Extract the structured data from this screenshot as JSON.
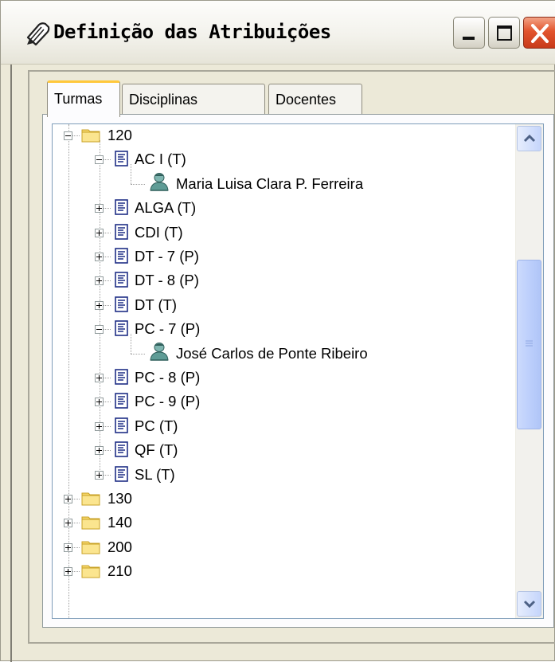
{
  "window": {
    "title": "Definição das Atribuições"
  },
  "tabs": [
    {
      "label": "Turmas",
      "active": true
    },
    {
      "label": "Disciplinas",
      "active": false
    },
    {
      "label": "Docentes",
      "active": false
    }
  ],
  "tree": [
    {
      "label": "120",
      "icon": "folder-icon",
      "expanded": true
    },
    {
      "label": "AC I (T)",
      "icon": "document-icon",
      "expanded": true
    },
    {
      "label": "Maria Luisa Clara P. Ferreira",
      "icon": "person-icon"
    },
    {
      "label": "ALGA (T)",
      "icon": "document-icon",
      "expanded": false
    },
    {
      "label": "CDI (T)",
      "icon": "document-icon",
      "expanded": false
    },
    {
      "label": "DT - 7 (P)",
      "icon": "document-icon",
      "expanded": false
    },
    {
      "label": "DT - 8 (P)",
      "icon": "document-icon",
      "expanded": false
    },
    {
      "label": "DT (T)",
      "icon": "document-icon",
      "expanded": false
    },
    {
      "label": "PC - 7 (P)",
      "icon": "document-icon",
      "expanded": true
    },
    {
      "label": "José Carlos de Ponte Ribeiro",
      "icon": "person-icon"
    },
    {
      "label": "PC - 8 (P)",
      "icon": "document-icon",
      "expanded": false
    },
    {
      "label": "PC - 9 (P)",
      "icon": "document-icon",
      "expanded": false
    },
    {
      "label": "PC (T)",
      "icon": "document-icon",
      "expanded": false
    },
    {
      "label": "QF (T)",
      "icon": "document-icon",
      "expanded": false
    },
    {
      "label": "SL (T)",
      "icon": "document-icon",
      "expanded": false
    },
    {
      "label": "130",
      "icon": "folder-icon",
      "expanded": false
    },
    {
      "label": "140",
      "icon": "folder-icon",
      "expanded": false
    },
    {
      "label": "200",
      "icon": "folder-icon",
      "expanded": false
    },
    {
      "label": "210",
      "icon": "folder-icon",
      "expanded": false
    }
  ],
  "colors": {
    "window_bg": "#ECE9D8",
    "close_button": "#E2542D",
    "tab_highlight": "#FFC83C",
    "scrollbar": "#C5D5FB"
  }
}
